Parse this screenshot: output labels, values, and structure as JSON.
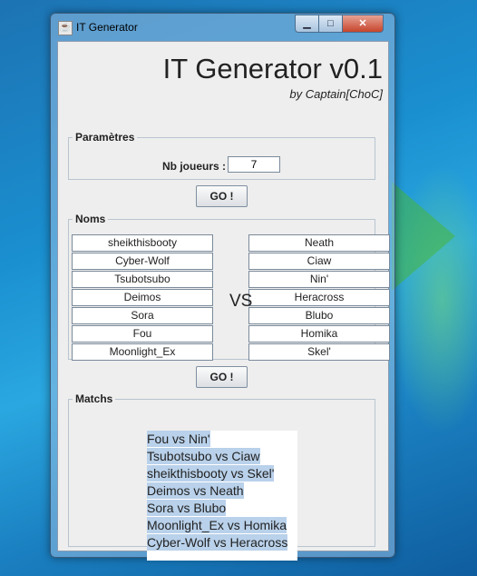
{
  "window": {
    "title": "IT Generator"
  },
  "header": {
    "title": "IT Generator v0.1",
    "subtitle": "by Captain[ChoC]"
  },
  "params": {
    "legend": "Paramètres",
    "nb_label": "Nb joueurs :",
    "nb_value": "7"
  },
  "go_label": "GO !",
  "noms": {
    "legend": "Noms",
    "vs": "VS",
    "left": [
      "sheikthisbooty",
      "Cyber-Wolf",
      "Tsubotsubo",
      "Deimos",
      "Sora",
      "Fou",
      "Moonlight_Ex"
    ],
    "right": [
      "Neath",
      "Ciaw",
      "Nin'",
      "Heracross",
      "Blubo",
      "Homika",
      "Skel'"
    ]
  },
  "matchs": {
    "legend": "Matchs",
    "lines": [
      "Fou vs Nin'",
      "Tsubotsubo vs Ciaw",
      "sheikthisbooty vs Skel'",
      "Deimos vs Neath",
      "Sora vs Blubo",
      "Moonlight_Ex vs Homika",
      "Cyber-Wolf vs Heracross"
    ]
  }
}
